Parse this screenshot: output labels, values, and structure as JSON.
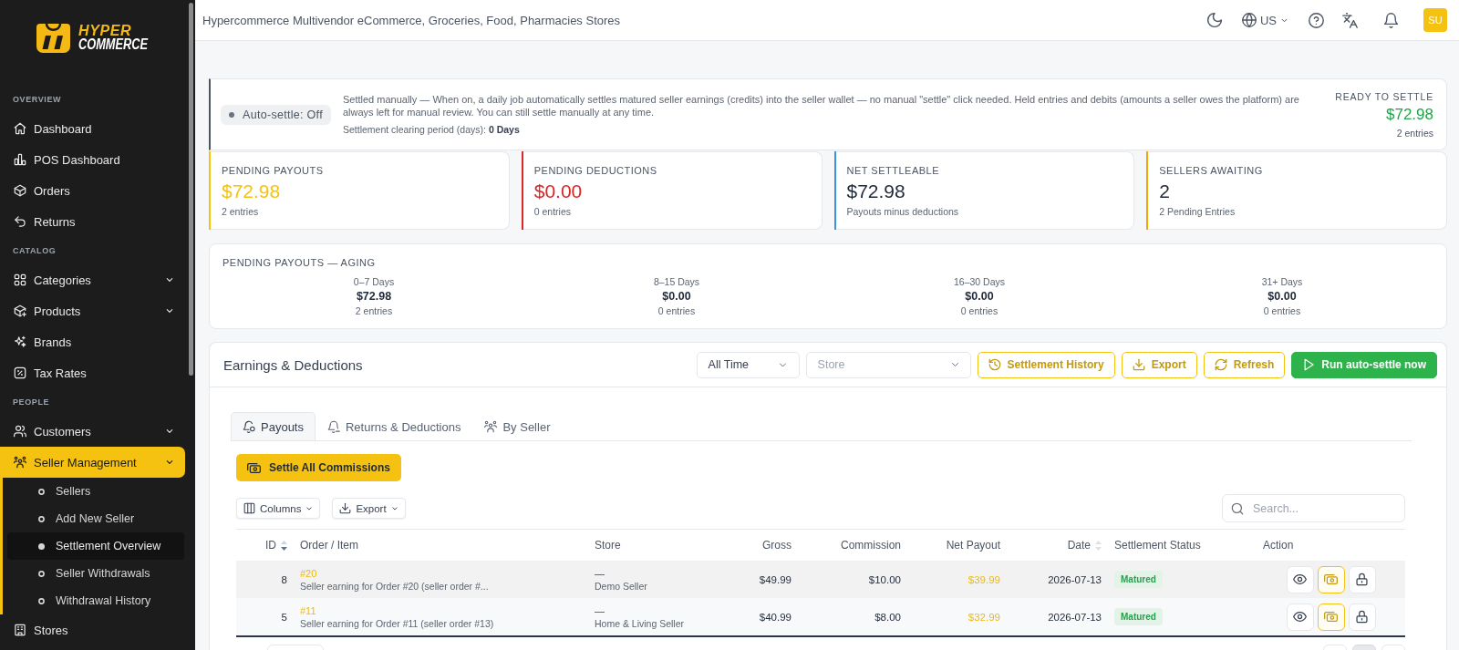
{
  "sidebar": {
    "logo": {
      "line_1": "HYPER",
      "line_2": "COMMERCE"
    },
    "sections": [
      {
        "label": "OVERVIEW",
        "items": [
          {
            "label": "Dashboard",
            "kind": "link",
            "selected": false
          },
          {
            "label": "POS Dashboard",
            "kind": "link",
            "selected": false
          },
          {
            "label": "Orders",
            "kind": "link",
            "selected": false
          },
          {
            "label": "Returns",
            "kind": "link",
            "selected": false
          }
        ]
      },
      {
        "label": "CATALOG",
        "items": [
          {
            "label": "Categories",
            "kind": "menu",
            "selected": false
          },
          {
            "label": "Products",
            "kind": "menu",
            "selected": false
          },
          {
            "label": "Brands",
            "kind": "link",
            "selected": false
          },
          {
            "label": "Tax Rates",
            "kind": "link",
            "selected": false
          }
        ]
      },
      {
        "label": "PEOPLE",
        "items": [
          {
            "label": "Customers",
            "kind": "menu",
            "selected": false
          },
          {
            "label": "Seller Management",
            "kind": "menu",
            "selected": true,
            "children": [
              {
                "label": "Sellers",
                "selected": false
              },
              {
                "label": "Add New Seller",
                "selected": false
              },
              {
                "label": "Settlement Overview",
                "selected": true
              },
              {
                "label": "Seller Withdrawals",
                "selected": false
              },
              {
                "label": "Withdrawal History",
                "selected": false
              }
            ]
          },
          {
            "label": "Stores",
            "kind": "link",
            "selected": false
          }
        ]
      }
    ]
  },
  "header": {
    "title": "Hypercommerce Multivendor eCommerce, Groceries, Food, Pharmacies Stores",
    "locale": "US",
    "avatar": "SU"
  },
  "auto_settle": {
    "badge": "Auto-settle: Off",
    "on": false,
    "description": "Settled manually — When on, a daily job automatically settles matured seller earnings (credits) into the seller wallet — no manual \"settle\" click needed. Held entries and debits (amounts a seller owes the platform) are always left for manual review. You can still settle manually at any time.",
    "clearing": "Settlement clearing period (days): **0 Days**",
    "ready": {
      "label": "READY TO SETTLE",
      "amount": "$72.98",
      "entries": "2 entries"
    }
  },
  "stats": [
    {
      "label": "PENDING PAYOUTS",
      "value": "$72.98",
      "note": "2 entries",
      "color": "#f5c211",
      "kind": "accent"
    },
    {
      "label": "PENDING DEDUCTIONS",
      "value": "$0.00",
      "note": "0 entries",
      "color": "#dc2626",
      "kind": "accent"
    },
    {
      "label": "NET SETTLEABLE",
      "value": "$72.98",
      "note": "Payouts minus deductions",
      "color": "#3b93e0",
      "kind": "plain"
    },
    {
      "label": "SELLERS AWAITING",
      "value": "2",
      "note": "2 Pending Entries",
      "color": "#f0a40b",
      "kind": "plain"
    }
  ],
  "aging": {
    "title": "PENDING PAYOUTS — AGING",
    "buckets": [
      {
        "label": "0–7 Days",
        "amount": "$72.98",
        "entries": "2 entries"
      },
      {
        "label": "8–15 Days",
        "amount": "$0.00",
        "entries": "0 entries"
      },
      {
        "label": "16–30 Days",
        "amount": "$0.00",
        "entries": "0 entries"
      },
      {
        "label": "31+ Days",
        "amount": "$0.00",
        "entries": "0 entries"
      }
    ]
  },
  "earnings": {
    "title": "Earnings & Deductions",
    "period": {
      "value": "All Time"
    },
    "store": {
      "placeholder": "Store"
    },
    "actions": [
      {
        "label": "Settlement History",
        "kind": "outline"
      },
      {
        "label": "Export",
        "kind": "outline"
      },
      {
        "label": "Refresh",
        "kind": "outline"
      },
      {
        "label": "Run auto-settle now",
        "kind": "primary"
      }
    ],
    "tabs": [
      {
        "label": "Payouts",
        "selected": true
      },
      {
        "label": "Returns & Deductions",
        "selected": false
      },
      {
        "label": "By Seller",
        "selected": false
      }
    ],
    "settle_all": "Settle All Commissions",
    "table_tools": [
      {
        "label": "Columns"
      },
      {
        "label": "Export"
      }
    ],
    "search": {
      "placeholder": "Search..."
    },
    "table": {
      "columns": [
        {
          "label": "ID",
          "sortable": true,
          "sorted": true
        },
        {
          "label": "Order / Item",
          "sortable": false,
          "sorted": false
        },
        {
          "label": "Store",
          "sortable": false,
          "sorted": false
        },
        {
          "label": "Gross",
          "sortable": false,
          "sorted": false
        },
        {
          "label": "Commission",
          "sortable": false,
          "sorted": false
        },
        {
          "label": "Net Payout",
          "sortable": false,
          "sorted": false
        },
        {
          "label": "Date",
          "sortable": true,
          "sorted": false
        },
        {
          "label": "Settlement Status",
          "sortable": false,
          "sorted": false
        },
        {
          "label": "Action",
          "sortable": false,
          "sorted": false
        }
      ],
      "rows": [
        {
          "id": "8",
          "order": "#20",
          "item": "Seller earning for Order #20 (seller order #...",
          "store_code": "—",
          "store": "Demo Seller",
          "gross": "$49.99",
          "commission": "$10.00",
          "net_payout": "$39.99",
          "date": "2026-07-13",
          "status": "Matured"
        },
        {
          "id": "5",
          "order": "#11",
          "item": "Seller earning for Order #11 (seller order #13)",
          "store_code": "—",
          "store": "Home & Living Seller",
          "gross": "$40.99",
          "commission": "$8.00",
          "net_payout": "$32.99",
          "date": "2026-07-13",
          "status": "Matured"
        }
      ]
    },
    "pagination": {
      "buttons": [
        {
          "selected": false
        },
        {
          "selected": true
        },
        {
          "selected": false
        }
      ]
    }
  }
}
